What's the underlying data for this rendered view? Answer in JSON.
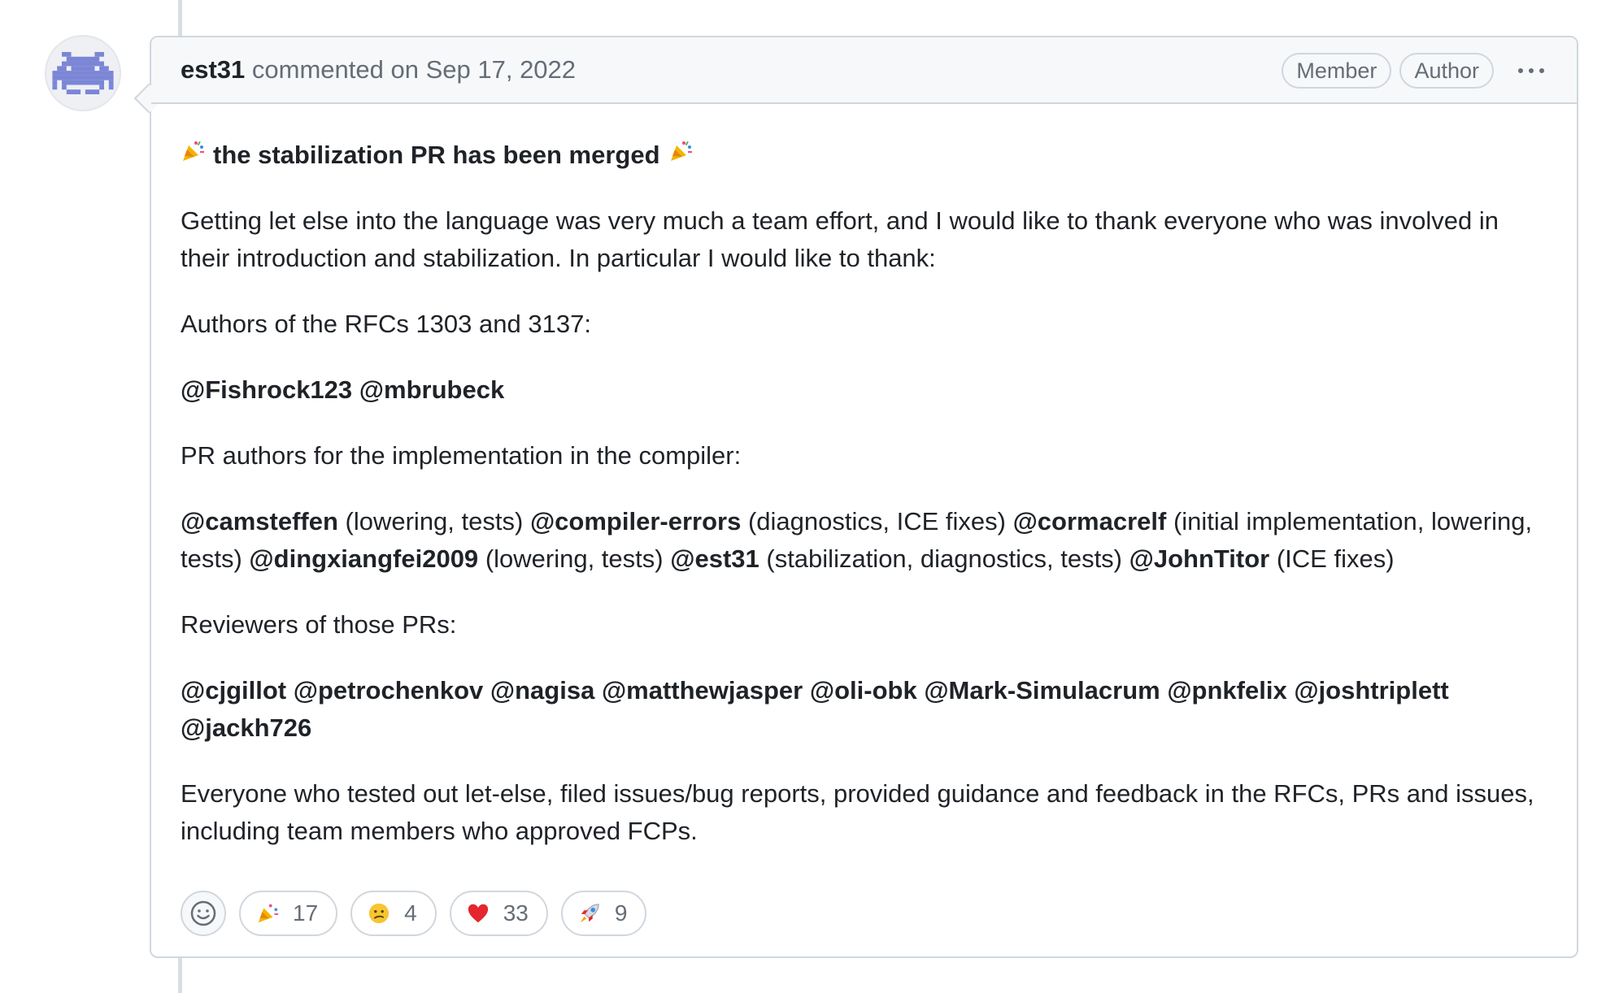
{
  "comment": {
    "author": "est31",
    "meta": "commented on Sep 17, 2022",
    "badges": [
      "Member",
      "Author"
    ],
    "colors": {
      "avatar": "#7b86d6",
      "border": "#d0d7de",
      "muted_text": "#656d76",
      "header_bg": "#f6f8fa"
    }
  },
  "body": {
    "title": "the stabilization PR has been merged",
    "title_emoji": "party-popper-icon",
    "intro": "Getting let else into the language was very much a team effort, and I would like to thank everyone who was involved in their introduction and stabilization. In particular I would like to thank:",
    "rfc_heading": "Authors of the RFCs 1303 and 3137:",
    "rfc_authors": [
      "@Fishrock123",
      "@mbrubeck"
    ],
    "pr_heading": "PR authors for the implementation in the compiler:",
    "pr_authors": [
      {
        "mention": "@camsteffen",
        "note": "(lowering, tests)"
      },
      {
        "mention": "@compiler-errors",
        "note": "(diagnostics, ICE fixes)"
      },
      {
        "mention": "@cormacrelf",
        "note": "(initial implementation, lowering, tests)"
      },
      {
        "mention": "@dingxiangfei2009",
        "note": "(lowering, tests)"
      },
      {
        "mention": "@est31",
        "note": "(stabilization, diagnostics, tests)"
      },
      {
        "mention": "@JohnTitor",
        "note": "(ICE fixes)"
      }
    ],
    "reviewers_heading": "Reviewers of those PRs:",
    "reviewers": [
      "@cjgillot",
      "@petrochenkov",
      "@nagisa",
      "@matthewjasper",
      "@oli-obk",
      "@Mark-Simulacrum",
      "@pnkfelix",
      "@joshtriplett",
      "@jackh726"
    ],
    "closing": "Everyone who tested out let-else, filed issues/bug reports, provided guidance and feedback in the RFCs, PRs and issues, including team members who approved FCPs."
  },
  "reactions": {
    "add_icon": "smiley-icon",
    "items": [
      {
        "icon": "party-popper-icon",
        "count": "17"
      },
      {
        "icon": "confused-face-icon",
        "count": "4"
      },
      {
        "icon": "heart-icon",
        "count": "33"
      },
      {
        "icon": "rocket-icon",
        "count": "9"
      }
    ]
  }
}
